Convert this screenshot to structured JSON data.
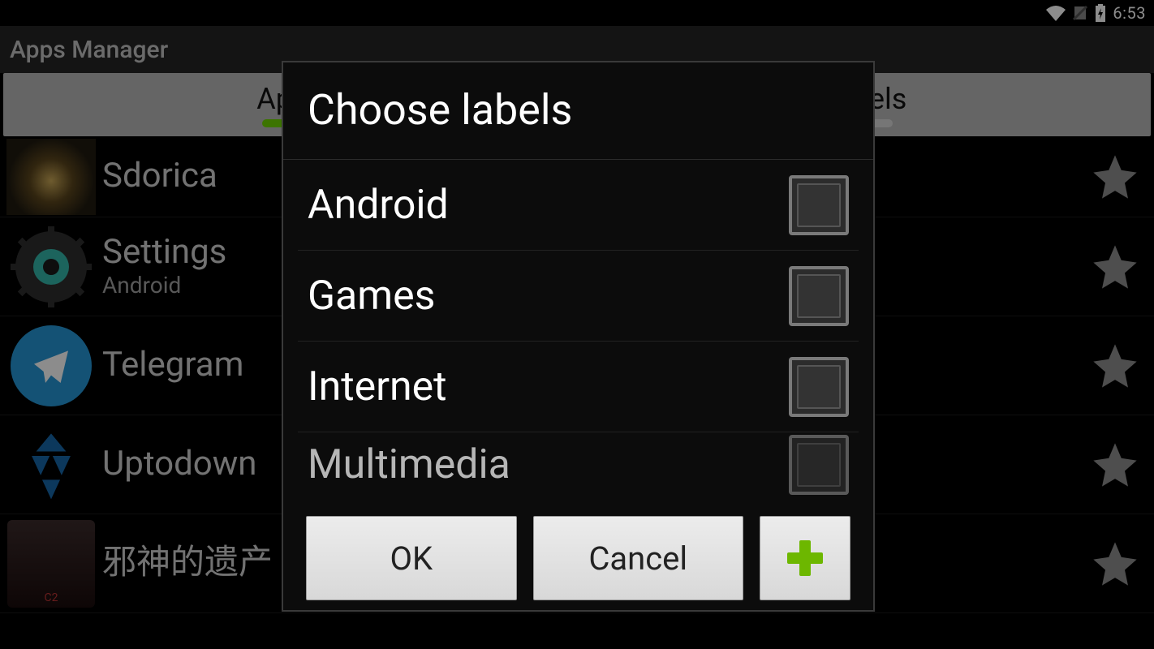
{
  "status_bar": {
    "time": "6:53"
  },
  "header": {
    "title": "Apps Manager"
  },
  "tabs": {
    "apps": "Apps",
    "labels": "Labels"
  },
  "apps": [
    {
      "name": "Sdorica",
      "sub": ""
    },
    {
      "name": "Settings",
      "sub": "Android"
    },
    {
      "name": "Telegram",
      "sub": ""
    },
    {
      "name": "Uptodown",
      "sub": ""
    },
    {
      "name": "邪神的遗产",
      "sub": ""
    }
  ],
  "dialog": {
    "title": "Choose labels",
    "items": [
      {
        "label": "Android",
        "checked": false
      },
      {
        "label": "Games",
        "checked": false
      },
      {
        "label": "Internet",
        "checked": false
      },
      {
        "label": "Multimedia",
        "checked": false
      }
    ],
    "ok": "OK",
    "cancel": "Cancel"
  }
}
